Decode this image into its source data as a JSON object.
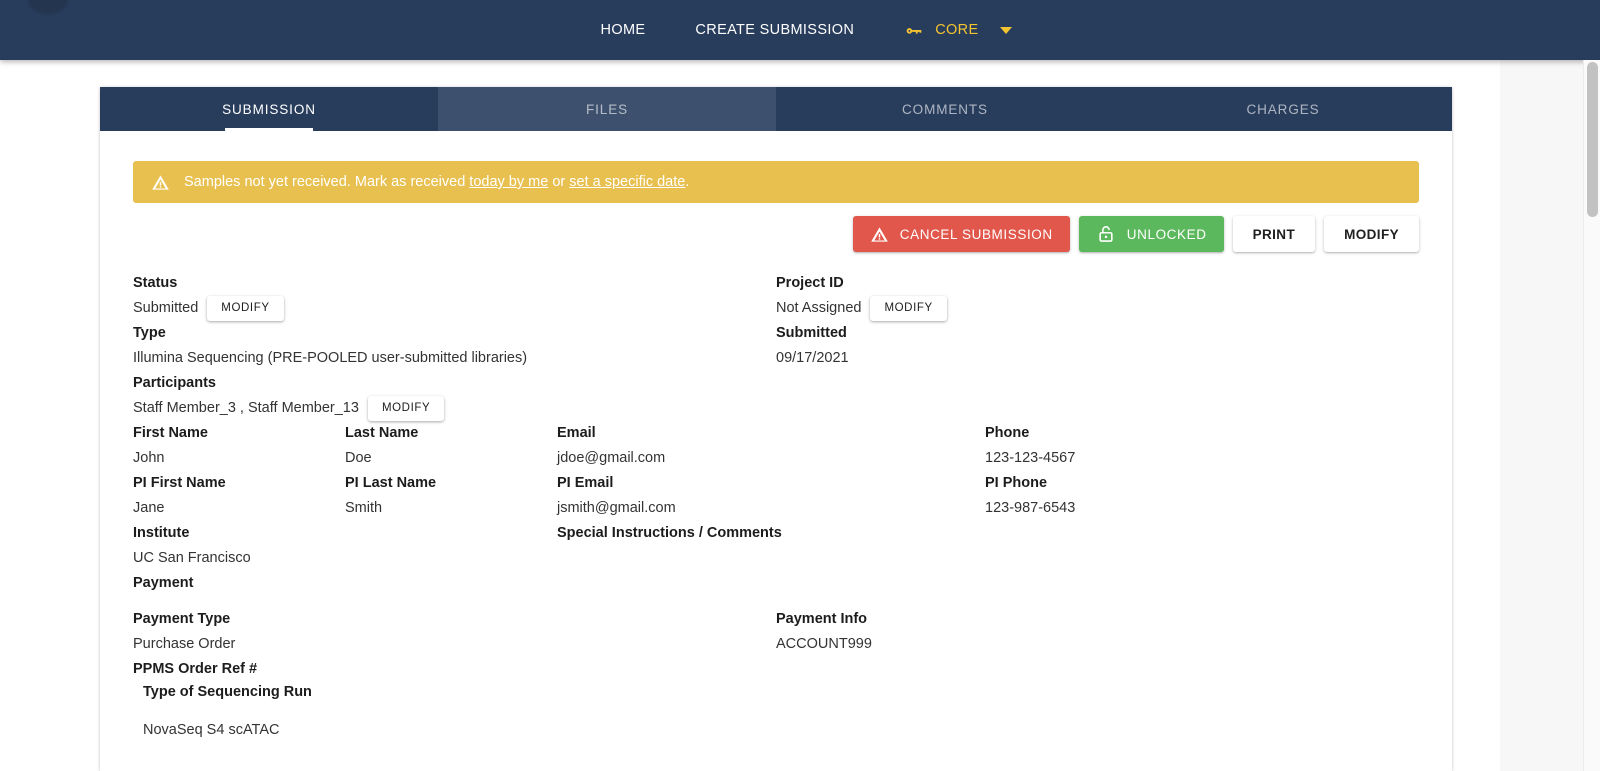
{
  "navbar": {
    "logo_icon": "logo-circle",
    "links": [
      {
        "label": "HOME"
      },
      {
        "label": "CREATE SUBMISSION"
      }
    ],
    "core": {
      "icon": "key-icon",
      "label": "CORE",
      "caret_icon": "chevron-down-icon",
      "accent_color": "#f4c430"
    },
    "background_color": "#283c5c"
  },
  "tabs": [
    {
      "label": "SUBMISSION",
      "state": "active"
    },
    {
      "label": "FILES",
      "state": "hovered"
    },
    {
      "label": "COMMENTS",
      "state": "default"
    },
    {
      "label": "CHARGES",
      "state": "default"
    }
  ],
  "alert": {
    "icon": "warning-triangle-icon",
    "text_before": "Samples not yet received. Mark as received ",
    "link1": "today by me",
    "text_middle": " or ",
    "link2": "set a specific date",
    "text_after": ".",
    "background_color": "#e8c04f"
  },
  "actions": {
    "cancel": {
      "label": "CANCEL SUBMISSION",
      "icon": "warning-triangle-icon",
      "color": "#e2574c"
    },
    "unlocked": {
      "label": "UNLOCKED",
      "icon": "unlock-icon",
      "color": "#5cb85c"
    },
    "print": {
      "label": "PRINT"
    },
    "modify": {
      "label": "MODIFY"
    }
  },
  "details": {
    "status": {
      "label": "Status",
      "value": "Submitted",
      "modify_label": "MODIFY"
    },
    "project_id": {
      "label": "Project ID",
      "value": "Not Assigned",
      "modify_label": "MODIFY"
    },
    "type": {
      "label": "Type",
      "value": "Illumina Sequencing (PRE-POOLED user-submitted libraries)"
    },
    "submitted": {
      "label": "Submitted",
      "value": "09/17/2021"
    },
    "participants": {
      "label": "Participants",
      "value": "Staff Member_3 , Staff Member_13",
      "modify_label": "MODIFY"
    },
    "first_name": {
      "label": "First Name",
      "value": "John"
    },
    "last_name": {
      "label": "Last Name",
      "value": "Doe"
    },
    "email": {
      "label": "Email",
      "value": "jdoe@gmail.com"
    },
    "phone": {
      "label": "Phone",
      "value": "123-123-4567"
    },
    "pi_first_name": {
      "label": "PI First Name",
      "value": "Jane"
    },
    "pi_last_name": {
      "label": "PI Last Name",
      "value": "Smith"
    },
    "pi_email": {
      "label": "PI Email",
      "value": "jsmith@gmail.com"
    },
    "pi_phone": {
      "label": "PI Phone",
      "value": "123-987-6543"
    },
    "institute": {
      "label": "Institute",
      "value": "UC San Francisco"
    },
    "special_instructions": {
      "label": "Special Instructions / Comments",
      "value": ""
    },
    "payment": {
      "label": "Payment"
    },
    "payment_type": {
      "label": "Payment Type",
      "value": "Purchase Order"
    },
    "payment_info": {
      "label": "Payment Info",
      "value": "ACCOUNT999"
    },
    "ppms_order_ref": {
      "label": "PPMS Order Ref #",
      "value": ""
    },
    "sequencing_run": {
      "label": "Type of Sequencing Run",
      "value": "NovaSeq S4 scATAC"
    }
  }
}
